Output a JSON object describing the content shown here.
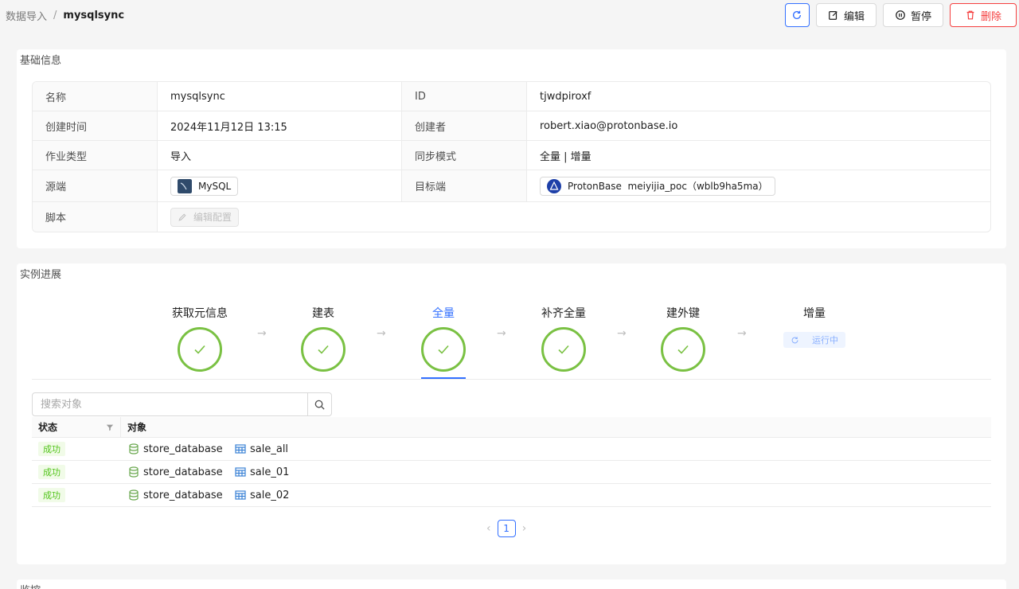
{
  "breadcrumb": {
    "parent": "数据导入",
    "separator": "/",
    "current": "mysqlsync"
  },
  "actions": {
    "edit": "编辑",
    "pause": "暂停",
    "delete": "删除"
  },
  "basic": {
    "title": "基础信息",
    "name_label": "名称",
    "name_value": "mysqlsync",
    "id_label": "ID",
    "id_value": "tjwdpiroxf",
    "created_label": "创建时间",
    "created_value": "2024年11月12日 13:15",
    "creator_label": "创建者",
    "creator_value": "robert.xiao@protonbase.io",
    "jobtype_label": "作业类型",
    "jobtype_value": "导入",
    "syncmode_label": "同步模式",
    "syncmode_value": "全量 | 增量",
    "source_label": "源端",
    "source_value": "MySQL",
    "target_label": "目标端",
    "target_value": "ProtonBase  meiyijia_poc（wblb9ha5ma）",
    "script_label": "脚本",
    "script_value": "编辑配置"
  },
  "progress": {
    "title": "实例进展",
    "steps": [
      {
        "label": "获取元信息"
      },
      {
        "label": "建表"
      },
      {
        "label": "全量"
      },
      {
        "label": "补齐全量"
      },
      {
        "label": "建外键"
      },
      {
        "label": "增量"
      }
    ],
    "arrow": "→",
    "running_label": "运行中",
    "search_placeholder": "搜索对象",
    "col_status": "状态",
    "col_object": "对象",
    "rows": [
      {
        "status": "成功",
        "db": "store_database",
        "table": "sale_all"
      },
      {
        "status": "成功",
        "db": "store_database",
        "table": "sale_01"
      },
      {
        "status": "成功",
        "db": "store_database",
        "table": "sale_02"
      }
    ],
    "page": "1",
    "prev": "‹",
    "next": "›"
  },
  "monitor": {
    "title": "监控"
  },
  "colors": {
    "accent": "#3370ff",
    "success": "#7ac143",
    "danger": "#f53f3f"
  }
}
